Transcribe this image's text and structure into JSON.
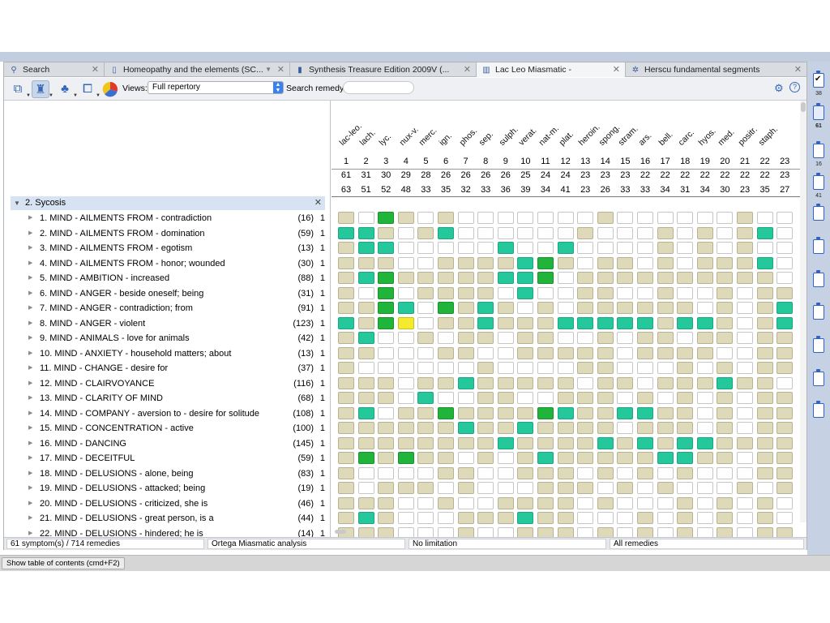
{
  "tabs": [
    {
      "label": "Search",
      "icon": "search-icon",
      "close": "✕"
    },
    {
      "label": "Homeopathy and the elements (SC...",
      "icon": "book-icon",
      "close": "✕",
      "dropdown": "▼"
    },
    {
      "label": "Synthesis Treasure Edition 2009V (...",
      "icon": "repertory-book-icon",
      "close": "✕"
    },
    {
      "label": "Lac Leo Miasmatic -",
      "icon": "bar-chart-icon",
      "close": "✕"
    },
    {
      "label": "Herscu fundamental segments",
      "icon": "segments-icon",
      "close": "✕"
    }
  ],
  "toolbar": {
    "views_label": "Views:",
    "views_value": "Full repertory",
    "search_label": "Search remedy:",
    "search_value": ""
  },
  "group": {
    "label": "2. Sycosis",
    "close": "✕"
  },
  "symptoms": [
    {
      "name": "1. MIND - AILMENTS FROM - contradiction",
      "count": "(16)",
      "weight": "1"
    },
    {
      "name": "2. MIND - AILMENTS FROM - domination",
      "count": "(59)",
      "weight": "1"
    },
    {
      "name": "3. MIND - AILMENTS FROM - egotism",
      "count": "(13)",
      "weight": "1"
    },
    {
      "name": "4. MIND - AILMENTS FROM - honor; wounded",
      "count": "(30)",
      "weight": "1"
    },
    {
      "name": "5. MIND - AMBITION - increased",
      "count": "(88)",
      "weight": "1"
    },
    {
      "name": "6. MIND - ANGER - beside oneself; being",
      "count": "(31)",
      "weight": "1"
    },
    {
      "name": "7. MIND - ANGER - contradiction; from",
      "count": "(91)",
      "weight": "1"
    },
    {
      "name": "8. MIND - ANGER - violent",
      "count": "(123)",
      "weight": "1"
    },
    {
      "name": "9. MIND - ANIMALS - love for animals",
      "count": "(42)",
      "weight": "1"
    },
    {
      "name": "10. MIND - ANXIETY - household matters; about",
      "count": "(13)",
      "weight": "1"
    },
    {
      "name": "11. MIND - CHANGE - desire for",
      "count": "(37)",
      "weight": "1"
    },
    {
      "name": "12. MIND - CLAIRVOYANCE",
      "count": "(116)",
      "weight": "1"
    },
    {
      "name": "13. MIND - CLARITY OF MIND",
      "count": "(68)",
      "weight": "1"
    },
    {
      "name": "14. MIND - COMPANY - aversion to - desire for solitude",
      "count": "(108)",
      "weight": "1"
    },
    {
      "name": "15. MIND - CONCENTRATION - active",
      "count": "(100)",
      "weight": "1"
    },
    {
      "name": "16. MIND - DANCING",
      "count": "(145)",
      "weight": "1"
    },
    {
      "name": "17. MIND - DECEITFUL",
      "count": "(59)",
      "weight": "1"
    },
    {
      "name": "18. MIND - DELUSIONS - alone, being",
      "count": "(83)",
      "weight": "1"
    },
    {
      "name": "19. MIND - DELUSIONS - attacked; being",
      "count": "(19)",
      "weight": "1"
    },
    {
      "name": "20. MIND - DELUSIONS - criticized, she is",
      "count": "(46)",
      "weight": "1"
    },
    {
      "name": "21. MIND - DELUSIONS - great person, is a",
      "count": "(44)",
      "weight": "1"
    },
    {
      "name": "22. MIND - DELUSIONS - hindered; he is",
      "count": "(14)",
      "weight": "1"
    }
  ],
  "remedies": [
    {
      "name": "lac-leo.",
      "rank": "1",
      "score": "61",
      "count": "63"
    },
    {
      "name": "lach.",
      "rank": "2",
      "score": "31",
      "count": "51"
    },
    {
      "name": "lyc.",
      "rank": "3",
      "score": "30",
      "count": "52"
    },
    {
      "name": "nux-v.",
      "rank": "4",
      "score": "29",
      "count": "48"
    },
    {
      "name": "merc.",
      "rank": "5",
      "score": "28",
      "count": "33"
    },
    {
      "name": "ign.",
      "rank": "6",
      "score": "26",
      "count": "35"
    },
    {
      "name": "phos.",
      "rank": "7",
      "score": "26",
      "count": "32"
    },
    {
      "name": "sep.",
      "rank": "8",
      "score": "26",
      "count": "33"
    },
    {
      "name": "sulph.",
      "rank": "9",
      "score": "26",
      "count": "36"
    },
    {
      "name": "verat.",
      "rank": "10",
      "score": "25",
      "count": "39"
    },
    {
      "name": "nat-m.",
      "rank": "11",
      "score": "24",
      "count": "34"
    },
    {
      "name": "plat.",
      "rank": "12",
      "score": "24",
      "count": "41"
    },
    {
      "name": "heroin.",
      "rank": "13",
      "score": "23",
      "count": "23"
    },
    {
      "name": "spong.",
      "rank": "14",
      "score": "23",
      "count": "26"
    },
    {
      "name": "stram.",
      "rank": "15",
      "score": "23",
      "count": "33"
    },
    {
      "name": "ars.",
      "rank": "16",
      "score": "22",
      "count": "33"
    },
    {
      "name": "bell.",
      "rank": "17",
      "score": "22",
      "count": "34"
    },
    {
      "name": "carc.",
      "rank": "18",
      "score": "22",
      "count": "31"
    },
    {
      "name": "hyos.",
      "rank": "19",
      "score": "22",
      "count": "34"
    },
    {
      "name": "med.",
      "rank": "20",
      "score": "22",
      "count": "30"
    },
    {
      "name": "positr.",
      "rank": "21",
      "score": "22",
      "count": "23"
    },
    {
      "name": "staph.",
      "rank": "22",
      "score": "22",
      "count": "35"
    },
    {
      "name": "",
      "rank": "23",
      "score": "23",
      "count": "27"
    }
  ],
  "grid_grades": [
    "10310100000001000000100",
    "22101200000010001010120",
    "12200000200200001010100",
    "11100111123101101011120",
    "12311111223011111111110",
    "10301111020011001001011",
    "11320312101011111101012",
    "21340112111222221221012",
    "12001011011001011011011",
    "11000110011111011110011",
    "10000001000011000101011",
    "11101121111101101112110",
    "11102001100111010101011",
    "12011311113211221101011",
    "11111121121111011101011",
    "11111111211112121221111",
    "13131101012111112211011",
    "10000110011101010100011",
    "10111010001110101000101",
    "11100100111101000101010",
    "12100011121100010101010",
    "11100010011101010101011"
  ],
  "grade_colors": {
    "0": "#ffffff",
    "1": "#ddd9b9",
    "2": "#24c89a",
    "3": "#20b43a",
    "4": "#f4ea2e"
  },
  "status": {
    "symptoms_remedies": "61 symptom(s) / 714 remedies",
    "analysis": "Ortega Miasmatic analysis",
    "limitation": "No limitation",
    "remedy_filter": "All remedies"
  },
  "toc_button": "Show table of contents (cmd+F2)",
  "clipboards": [
    {
      "number": "38",
      "checked": true
    },
    {
      "number": "61",
      "checked": false,
      "active": true
    },
    {
      "number": "16",
      "checked": false
    },
    {
      "number": "41",
      "checked": false
    },
    {
      "number": "",
      "checked": false
    },
    {
      "number": "",
      "checked": false
    },
    {
      "number": "",
      "checked": false
    },
    {
      "number": "",
      "checked": false
    },
    {
      "number": "",
      "checked": false
    },
    {
      "number": "",
      "checked": false
    },
    {
      "number": "",
      "checked": false
    }
  ]
}
